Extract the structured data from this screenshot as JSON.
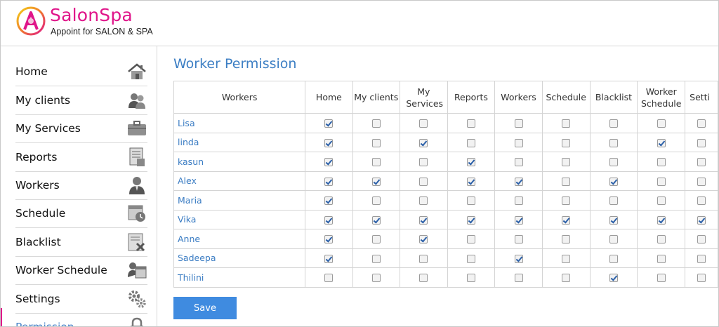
{
  "brand": {
    "name": "SalonSpa",
    "tagline": "Appoint for SALON & SPA",
    "accent": "#e0158a"
  },
  "sidebar": {
    "items": [
      {
        "label": "Home",
        "icon": "home-icon"
      },
      {
        "label": "My clients",
        "icon": "clients-icon"
      },
      {
        "label": "My Services",
        "icon": "briefcase-icon"
      },
      {
        "label": "Reports",
        "icon": "report-icon"
      },
      {
        "label": "Workers",
        "icon": "worker-icon"
      },
      {
        "label": "Schedule",
        "icon": "schedule-icon"
      },
      {
        "label": "Blacklist",
        "icon": "blacklist-icon"
      },
      {
        "label": "Worker Schedule",
        "icon": "calendar-icon"
      },
      {
        "label": "Settings",
        "icon": "gear-icon"
      },
      {
        "label": "Permission",
        "icon": "lock-icon"
      }
    ]
  },
  "main": {
    "title": "Worker Permission",
    "columns": [
      "Workers",
      "Home",
      "My clients",
      "My Services",
      "Reports",
      "Workers",
      "Schedule",
      "Blacklist",
      "Worker Schedule",
      "Setti"
    ],
    "rows": [
      {
        "name": "Lisa",
        "perms": [
          true,
          false,
          false,
          false,
          false,
          false,
          false,
          false,
          false
        ]
      },
      {
        "name": "linda",
        "perms": [
          true,
          false,
          true,
          false,
          false,
          false,
          false,
          true,
          false
        ]
      },
      {
        "name": "kasun",
        "perms": [
          true,
          false,
          false,
          true,
          false,
          false,
          false,
          false,
          false
        ]
      },
      {
        "name": "Alex",
        "perms": [
          true,
          true,
          false,
          true,
          true,
          false,
          true,
          false,
          false
        ]
      },
      {
        "name": "Maria",
        "perms": [
          true,
          false,
          false,
          false,
          false,
          false,
          false,
          false,
          false
        ]
      },
      {
        "name": "Vika",
        "perms": [
          true,
          true,
          true,
          true,
          true,
          true,
          true,
          true,
          true
        ]
      },
      {
        "name": "Anne",
        "perms": [
          true,
          false,
          true,
          false,
          false,
          false,
          false,
          false,
          false
        ]
      },
      {
        "name": "Sadeepa",
        "perms": [
          true,
          false,
          false,
          false,
          true,
          false,
          false,
          false,
          false
        ]
      },
      {
        "name": "Thilini",
        "perms": [
          false,
          false,
          false,
          false,
          false,
          false,
          true,
          false,
          false
        ]
      }
    ],
    "save_label": "Save"
  }
}
